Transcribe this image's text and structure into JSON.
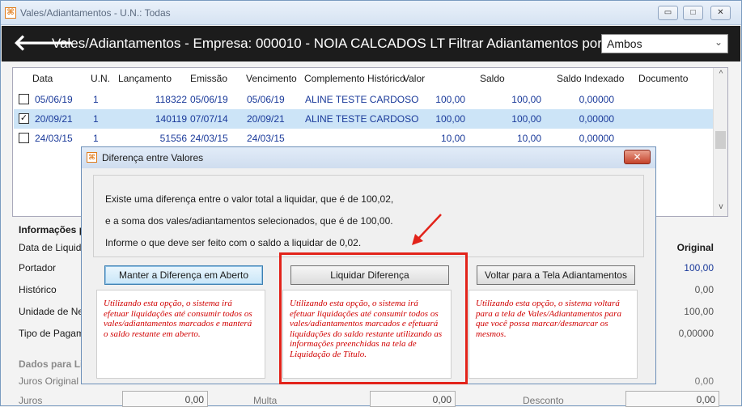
{
  "window": {
    "title": "Vales/Adiantamentos - U.N.: Todas",
    "min": "▭",
    "max": "□",
    "close": "✕"
  },
  "header": {
    "title": "Vales/Adiantamentos - Empresa: 000010 - NOIA CALCADOS LT",
    "filter_label": "Filtrar Adiantamentos por",
    "filter_value": "Ambos"
  },
  "grid": {
    "columns": [
      "Data",
      "U.N.",
      "Lançamento",
      "Emissão",
      "Vencimento",
      "Complemento Histórico",
      "Valor",
      "Saldo",
      "Saldo Indexado",
      "Documento"
    ],
    "rows": [
      {
        "check": "",
        "data": "05/06/19",
        "un": "1",
        "lanc": "118322",
        "emissao": "05/06/19",
        "venc": "05/06/19",
        "hist": "ALINE TESTE CARDOSO",
        "valor": "100,00",
        "saldo": "100,00",
        "idx": "0,00000"
      },
      {
        "check": "✓",
        "data": "20/09/21",
        "un": "1",
        "lanc": "140119",
        "emissao": "07/07/14",
        "venc": "20/09/21",
        "hist": "ALINE TESTE CARDOSO",
        "valor": "100,00",
        "saldo": "100,00",
        "idx": "0,00000"
      },
      {
        "check": "",
        "data": "24/03/15",
        "un": "1",
        "lanc": "51556",
        "emissao": "24/03/15",
        "venc": "24/03/15",
        "hist": "",
        "valor": "10,00",
        "saldo": "10,00",
        "idx": "0,00000"
      }
    ]
  },
  "info": {
    "title": "Informações p",
    "labels": [
      "Data de Liquidaç",
      "Portador",
      "Histórico",
      "Unidade de Nego",
      "Tipo de Pagamen"
    ],
    "original_header": "Original",
    "values": [
      "100,00",
      "0,00",
      "100,00",
      "0,00000"
    ]
  },
  "dados": {
    "title": "Dados para Li",
    "juros_original_label": "Juros Original",
    "juros_original_value": "0,00",
    "juros_label": "Juros",
    "juros_value": "0,00",
    "multa_label": "Multa",
    "multa_value": "0,00",
    "desconto_label": "Desconto",
    "desconto_value": "0,00"
  },
  "dialog": {
    "title": "Diferença entre Valores",
    "close": "✕",
    "messages": [
      "Existe uma diferença entre o valor total a liquidar, que é de 100,02,",
      "e a soma dos vales/adiantamentos selecionados, que é de 100,00.",
      "Informe o que deve ser feito com o saldo a liquidar de 0,02."
    ],
    "buttons": [
      "Manter a Diferença em Aberto",
      "Liquidar Diferença",
      "Voltar para a Tela Adiantamentos"
    ],
    "descriptions": [
      "Utilizando esta opção, o sistema irá efetuar liquidações até consumir todos os vales/adiantamentos marcados e manterá o saldo restante em aberto.",
      "Utilizando esta opção, o sistema irá efetuar liquidações até consumir todos os vales/adiantamentos marcados e efetuará liquidações do saldo restante utilizando as informações preenchidas na tela de Liquidação de Título.",
      "Utilizando esta opção, o sistema voltará para a tela de Vales/Adiantamentos para que você possa marcar/desmarcar os mesmos."
    ]
  },
  "colors": {
    "highlight": "#e2231a",
    "description_text": "#d00000",
    "selected_row": "#cce4f7",
    "header_bg": "#1c1c1c"
  }
}
